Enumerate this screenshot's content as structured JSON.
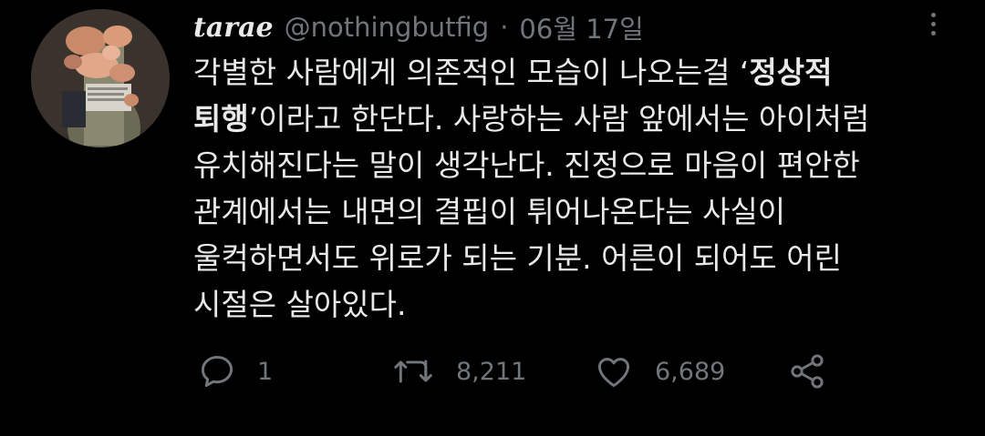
{
  "user": {
    "display_name": "tarae",
    "handle": "@nothingbutfig",
    "separator": "·",
    "date": "06월 17일"
  },
  "tweet": {
    "line1_a": "각별한 사람에게 의존적인 모습이 나오는걸 ‘",
    "line1_bold": "정상적",
    "line2_bold": "퇴행",
    "line2_b": "’이라고 한단다. 사랑하는 사람 앞에서는 아이처럼",
    "line3": "유치해진다는 말이 생각난다. 진정으로 마음이 편안한",
    "line4": "관계에서는 내면의 결핍이 튀어나온다는 사실이",
    "line5": "울컥하면서도 위로가 되는 기분. 어른이 되어도 어린",
    "line6": "시절은 살아있다."
  },
  "actions": {
    "reply": {
      "icon": "reply-icon",
      "count": "1"
    },
    "retweet": {
      "icon": "retweet-icon",
      "count": "8,211"
    },
    "like": {
      "icon": "heart-icon",
      "count": "6,689"
    },
    "share": {
      "icon": "share-icon"
    }
  },
  "colors": {
    "background": "#000000",
    "text": "#e7e9ea",
    "secondary": "#71767b"
  }
}
